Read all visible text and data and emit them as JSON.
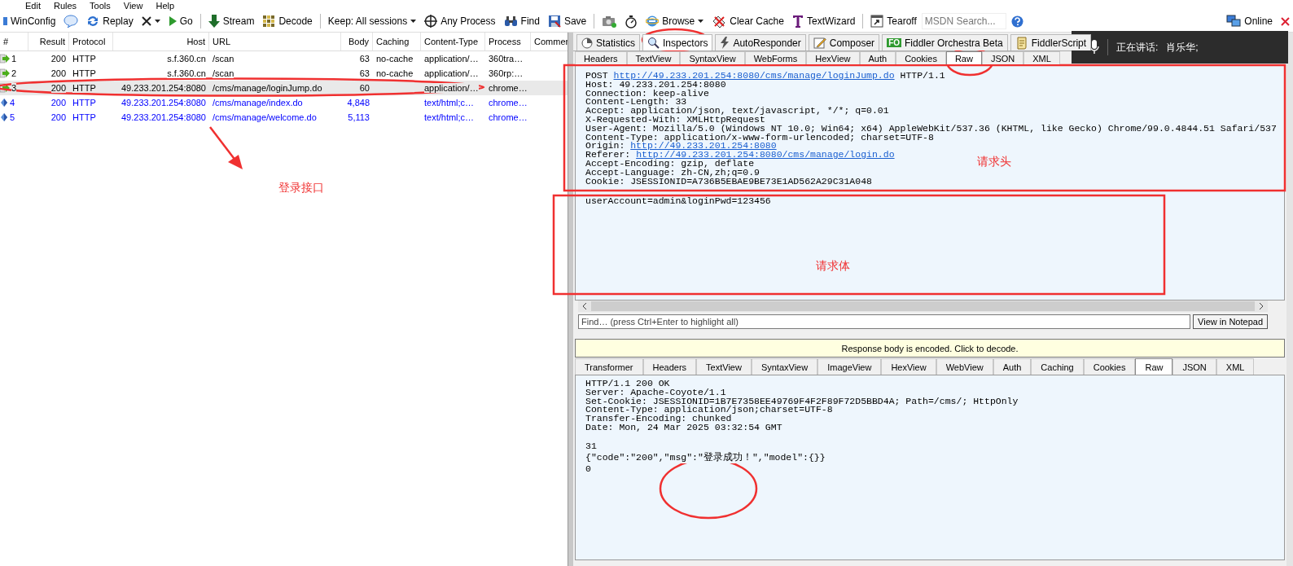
{
  "menu": [
    "Edit",
    "Rules",
    "Tools",
    "View",
    "Help"
  ],
  "toolbar": [
    {
      "kind": "winconfig",
      "label": "WinConfig"
    },
    {
      "kind": "comment"
    },
    {
      "kind": "replay",
      "label": "Replay"
    },
    {
      "kind": "remove",
      "dropdown": true
    },
    {
      "kind": "go",
      "label": "Go"
    },
    {
      "kind": "separator"
    },
    {
      "kind": "stream",
      "label": "Stream"
    },
    {
      "kind": "decode",
      "label": "Decode"
    },
    {
      "kind": "separator"
    },
    {
      "kind": "keep",
      "label": "Keep: All sessions",
      "dropdown": true
    },
    {
      "kind": "process",
      "label": "Any Process"
    },
    {
      "kind": "find",
      "label": "Find"
    },
    {
      "kind": "save",
      "label": "Save"
    },
    {
      "kind": "separator"
    },
    {
      "kind": "camera"
    },
    {
      "kind": "timer"
    },
    {
      "kind": "browse",
      "label": "Browse",
      "dropdown": true
    },
    {
      "kind": "clear",
      "label": "Clear Cache"
    },
    {
      "kind": "textwizard",
      "label": "TextWizard"
    },
    {
      "kind": "separator"
    },
    {
      "kind": "tearoff",
      "label": "Tearoff"
    },
    {
      "kind": "search",
      "placeholder": "MSDN Search..."
    },
    {
      "kind": "help"
    }
  ],
  "toolbar_right": [
    {
      "kind": "online",
      "label": "Online"
    },
    {
      "kind": "close"
    }
  ],
  "sessions": {
    "columns": [
      "#",
      "Result",
      "Protocol",
      "Host",
      "URL",
      "Body",
      "Caching",
      "Content-Type",
      "Process",
      "Commer"
    ],
    "rows": [
      {
        "kind": "arrow",
        "num": "1",
        "result": "200",
        "protocol": "HTTP",
        "host": "s.f.360.cn",
        "url": "/scan",
        "body": "63",
        "caching": "no-cache",
        "content_type": "application/…",
        "process": "360tra…",
        "color": "#000000",
        "selected": false
      },
      {
        "kind": "arrow",
        "num": "2",
        "result": "200",
        "protocol": "HTTP",
        "host": "s.f.360.cn",
        "url": "/scan",
        "body": "63",
        "caching": "no-cache",
        "content_type": "application/…",
        "process": "360rp:…",
        "color": "#000000",
        "selected": false
      },
      {
        "kind": "arrow",
        "num": "3",
        "result": "200",
        "protocol": "HTTP",
        "host": "49.233.201.254:8080",
        "url": "/cms/manage/loginJump.do",
        "body": "60",
        "caching": "",
        "content_type": "application/…",
        "process": "chrome…",
        "color": "#000000",
        "selected": true
      },
      {
        "kind": "diamond",
        "num": "4",
        "result": "200",
        "protocol": "HTTP",
        "host": "49.233.201.254:8080",
        "url": "/cms/manage/index.do",
        "body": "4,848",
        "caching": "",
        "content_type": "text/html;c…",
        "process": "chrome…",
        "color": "#0000ff",
        "selected": false
      },
      {
        "kind": "diamond",
        "num": "5",
        "result": "200",
        "protocol": "HTTP",
        "host": "49.233.201.254:8080",
        "url": "/cms/manage/welcome.do",
        "body": "5,113",
        "caching": "",
        "content_type": "text/html;c…",
        "process": "chrome…",
        "color": "#0000ff",
        "selected": false
      }
    ]
  },
  "tabs": [
    {
      "kind": "chart",
      "label": "Statistics",
      "selected": false
    },
    {
      "kind": "inspect",
      "label": "Inspectors",
      "selected": true
    },
    {
      "kind": "bolt",
      "label": "AutoResponder",
      "selected": false
    },
    {
      "kind": "pencil",
      "label": "Composer",
      "selected": false
    },
    {
      "kind": "badge",
      "badge": "FO",
      "label": "Fiddler Orchestra Beta",
      "selected": false
    },
    {
      "kind": "script",
      "label": "FiddlerScript",
      "selected": false
    }
  ],
  "request": {
    "tabs": [
      {
        "label": "Headers",
        "selected": false
      },
      {
        "label": "TextView",
        "selected": false
      },
      {
        "label": "SyntaxView",
        "selected": false
      },
      {
        "label": "WebForms",
        "selected": false
      },
      {
        "label": "HexView",
        "selected": false
      },
      {
        "label": "Auth",
        "selected": false
      },
      {
        "label": "Cookies",
        "selected": false
      },
      {
        "label": "Raw",
        "selected": true
      },
      {
        "label": "JSON",
        "selected": false
      },
      {
        "label": "XML",
        "selected": false
      }
    ],
    "lines": [
      [
        {
          "text": "POST "
        },
        {
          "text": "http://49.233.201.254:8080/cms/manage/loginJump.do",
          "link": true
        },
        {
          "text": " HTTP/1.1"
        }
      ],
      [
        {
          "text": "Host: 49.233.201.254:8080"
        }
      ],
      [
        {
          "text": "Connection: keep-alive"
        }
      ],
      [
        {
          "text": "Content-Length: 33"
        }
      ],
      [
        {
          "text": "Accept: application/json, text/javascript, */*; q=0.01"
        }
      ],
      [
        {
          "text": "X-Requested-With: XMLHttpRequest"
        }
      ],
      [
        {
          "text": "User-Agent: Mozilla/5.0 (Windows NT 10.0; Win64; x64) AppleWebKit/537.36 (KHTML, like Gecko) Chrome/99.0.4844.51 Safari/537"
        }
      ],
      [
        {
          "text": "Content-Type: application/x-www-form-urlencoded; charset=UTF-8"
        }
      ],
      [
        {
          "text": "Origin: "
        },
        {
          "text": "http://49.233.201.254:8080",
          "link": true
        }
      ],
      [
        {
          "text": "Referer: "
        },
        {
          "text": "http://49.233.201.254:8080/cms/manage/login.do",
          "link": true
        }
      ],
      [
        {
          "text": "Accept-Encoding: gzip, deflate"
        }
      ],
      [
        {
          "text": "Accept-Language: zh-CN,zh;q=0.9"
        }
      ],
      [
        {
          "text": "Cookie: JSESSIONID=A736B5EBAE9BE73E1AD562A29C31A048"
        }
      ]
    ],
    "body": "userAccount=admin&loginPwd=123456",
    "find": {
      "placeholder": "Find… (press Ctrl+Enter to highlight all)"
    },
    "notepad_button": "View in Notepad"
  },
  "response": {
    "notice": "Response body is encoded. Click to decode.",
    "tabs": [
      {
        "label": "Transformer",
        "selected": false
      },
      {
        "label": "Headers",
        "selected": false
      },
      {
        "label": "TextView",
        "selected": false
      },
      {
        "label": "SyntaxView",
        "selected": false
      },
      {
        "label": "ImageView",
        "selected": false
      },
      {
        "label": "HexView",
        "selected": false
      },
      {
        "label": "WebView",
        "selected": false
      },
      {
        "label": "Auth",
        "selected": false
      },
      {
        "label": "Caching",
        "selected": false
      },
      {
        "label": "Cookies",
        "selected": false
      },
      {
        "label": "Raw",
        "selected": true
      },
      {
        "label": "JSON",
        "selected": false
      },
      {
        "label": "XML",
        "selected": false
      }
    ],
    "headers": [
      "HTTP/1.1 200 OK",
      "Server: Apache-Coyote/1.1",
      "Set-Cookie: JSESSIONID=1B7E7358EE49769F4F2F89F72D5BBD4A; Path=/cms/; HttpOnly",
      "Content-Type: application/json;charset=UTF-8",
      "Transfer-Encoding: chunked",
      "Date: Mon, 24 Mar 2025 03:32:54 GMT"
    ],
    "body": [
      "31",
      "{\"code\":\"200\",\"msg\":\"登录成功！\",\"model\":{}}",
      "0"
    ]
  },
  "voice_overlay": {
    "label": "正在讲话:",
    "speaker": "肖乐华;"
  },
  "annotations": [
    {
      "text": "登录接口"
    },
    {
      "text": "请求头"
    },
    {
      "text": "请求体"
    }
  ]
}
